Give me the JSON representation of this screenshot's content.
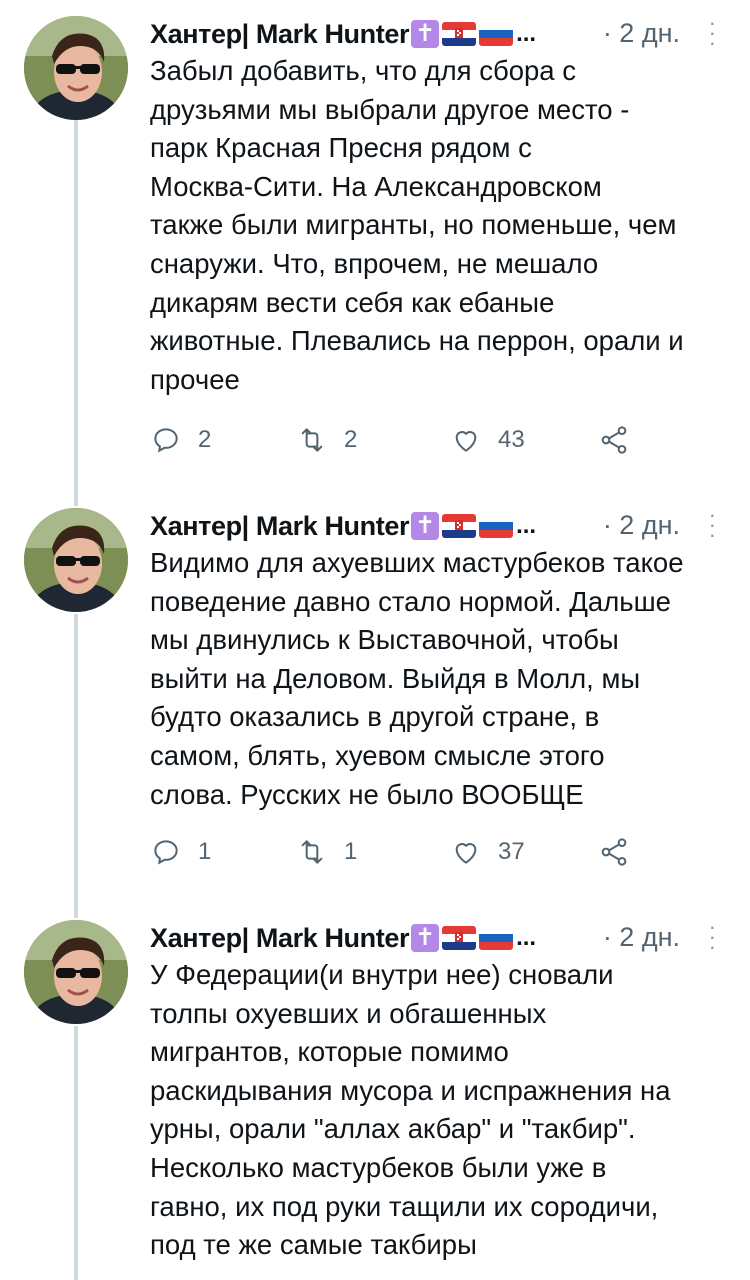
{
  "author": {
    "name": "Хантер| Mark Hunter",
    "emoji_icons": [
      "latin-cross-icon",
      "croatia-flag-icon",
      "russia-flag-icon"
    ],
    "truncation": "..."
  },
  "tweets": [
    {
      "time": "· 2 дн.",
      "text": "Забыл добавить, что для сбора с\nдрузьями мы выбрали другое место -\nпарк Красная Пресня рядом с\nМосква-Сити. На Александровском\nтакже были мигранты, но поменьше, чем\nснаружи. Что, впрочем, не мешало\nдикарям вести себя как ебаные\nживотные. Плевались на перрон, орали и\nпрочее",
      "replies": "2",
      "retweets": "2",
      "likes": "43"
    },
    {
      "time": "· 2 дн.",
      "text": "Видимо для ахуевших мастурбеков такое\nповедение давно стало нормой. Дальше\nмы двинулись к Выставочной, чтобы\nвыйти на Деловом. Выйдя в Молл, мы\nбудто оказались в другой стране, в\nсамом, блять, хуевом смысле этого\nслова. Русских не было ВООБЩЕ",
      "replies": "1",
      "retweets": "1",
      "likes": "37"
    },
    {
      "time": "· 2 дн.",
      "text": "У Федерации(и внутри нее) сновали\nтолпы охуевших и обгашенных\nмигрантов, которые помимо\nраскидывания мусора и испражнения на\nурны, орали \"аллах акбар\" и \"такбир\".\nНесколько мастурбеков были уже в\nгавно, их под руки тащили их сородичи,\nпод те же самые такбиры",
      "replies": "",
      "retweets": "",
      "likes": ""
    }
  ],
  "colors": {
    "text": "#0f1419",
    "secondary": "#536471",
    "thread_line": "#cfd9de"
  }
}
